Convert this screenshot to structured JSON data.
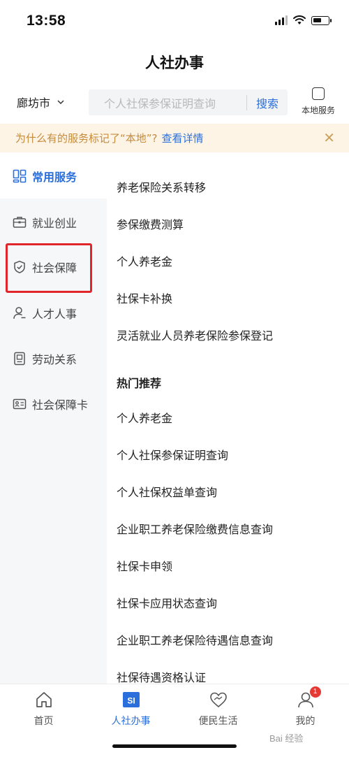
{
  "status_bar": {
    "time": "13:58"
  },
  "header": {
    "title": "人社办事"
  },
  "search": {
    "city": "廊坊市",
    "placeholder": "个人社保参保证明查询",
    "button": "搜索",
    "local_service_label": "本地服务"
  },
  "notice": {
    "text": "为什么有的服务标记了“本地”?",
    "link": "查看详情"
  },
  "sidebar": {
    "items": [
      {
        "label": "常用服务",
        "icon": "grid-icon",
        "active": true
      },
      {
        "label": "就业创业",
        "icon": "briefcase-icon"
      },
      {
        "label": "社会保障",
        "icon": "shield-icon"
      },
      {
        "label": "人才人事",
        "icon": "person-icon"
      },
      {
        "label": "劳动关系",
        "icon": "document-icon"
      },
      {
        "label": "社会保障卡",
        "icon": "id-card-icon"
      }
    ]
  },
  "services": {
    "common": [
      "养老保险关系转移",
      "参保缴费测算",
      "个人养老金",
      "社保卡补换",
      "灵活就业人员养老保险参保登记"
    ],
    "hot_title": "热门推荐",
    "hot": [
      "个人养老金",
      "个人社保参保证明查询",
      "个人社保权益单查询",
      "企业职工养老保险缴费信息查询",
      "社保卡申领",
      "社保卡应用状态查询",
      "企业职工养老保险待遇信息查询",
      "社保待遇资格认证"
    ]
  },
  "tabbar": {
    "items": [
      {
        "label": "首页",
        "icon": "home-icon"
      },
      {
        "label": "人社办事",
        "icon": "si-icon",
        "active": true,
        "icon_text": "SI"
      },
      {
        "label": "便民生活",
        "icon": "heart-hands-icon"
      },
      {
        "label": "我的",
        "icon": "user-icon",
        "badge": "1"
      }
    ]
  },
  "watermark": "Bai 经验",
  "colors": {
    "accent": "#2a6fdc",
    "notice_bg": "#fdf4e6",
    "highlight": "#e0262b"
  }
}
